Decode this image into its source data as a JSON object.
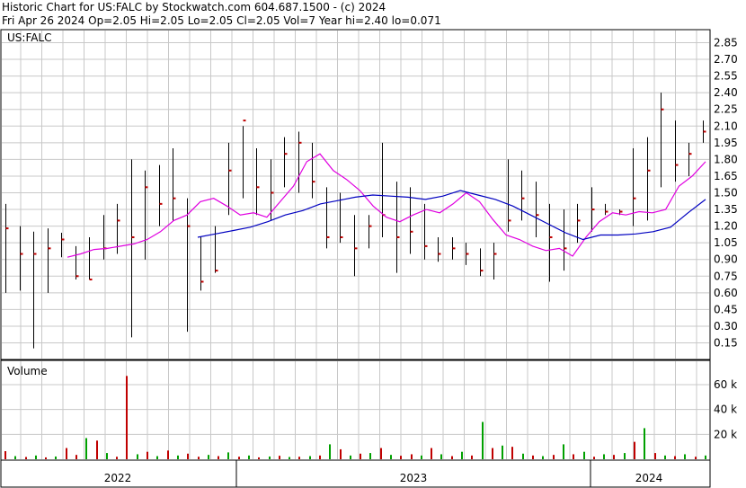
{
  "header": {
    "title": "Historic Chart for US:FALC by Stockwatch.com 604.687.1500 - (c) 2024",
    "quote": "Fri Apr 26 2024   Op=2.05  Hi=2.05  Lo=2.05  Cl=2.05  Vol=7  Year hi=2.40  lo=0.071"
  },
  "colors": {
    "ma_short": "#e000e0",
    "ma_long": "#0000c0",
    "up": "#00a000",
    "down": "#c00000",
    "grid": "#c8c8c8",
    "price_bar": "#000000",
    "close_tick": "#c00000"
  },
  "chart_data": [
    {
      "type": "line",
      "title": "US:FALC",
      "y_ticks": [
        "2.85",
        "2.70",
        "2.55",
        "2.40",
        "2.25",
        "2.10",
        "1.95",
        "1.80",
        "1.65",
        "1.50",
        "1.35",
        "1.20",
        "1.05",
        "0.90",
        "0.75",
        "0.60",
        "0.45",
        "0.30",
        "0.15"
      ],
      "ylim": [
        0,
        2.9
      ],
      "x_labels": [
        "2022",
        "2023",
        "2024"
      ],
      "x_range": [
        "2021-07",
        "2024-04"
      ],
      "series": [
        {
          "values": [
            0.92,
            0.95,
            0.99,
            1.0,
            1.02,
            1.04,
            1.08,
            1.15,
            1.25,
            1.3,
            1.42,
            1.45,
            1.38,
            1.3,
            1.32,
            1.28,
            1.42,
            1.56,
            1.78,
            1.85,
            1.7,
            1.62,
            1.52,
            1.38,
            1.28,
            1.24,
            1.3,
            1.35,
            1.32,
            1.4,
            1.5,
            1.42,
            1.26,
            1.12,
            1.08,
            1.02,
            0.98,
            1.0,
            0.93,
            1.1,
            1.24,
            1.32,
            1.3,
            1.33,
            1.32,
            1.35,
            1.56,
            1.65,
            1.78
          ]
        },
        {
          "values": [
            1.1,
            1.13,
            1.16,
            1.19,
            1.24,
            1.3,
            1.34,
            1.4,
            1.43,
            1.46,
            1.48,
            1.47,
            1.46,
            1.44,
            1.47,
            1.52,
            1.48,
            1.44,
            1.38,
            1.3,
            1.22,
            1.14,
            1.08,
            1.12,
            1.12,
            1.13,
            1.15,
            1.19,
            1.32,
            1.44
          ]
        }
      ],
      "bars": [
        {
          "hi": 1.4,
          "lo": 0.6,
          "cl": 1.18
        },
        {
          "hi": 1.2,
          "lo": 0.62,
          "cl": 0.95
        },
        {
          "hi": 1.15,
          "lo": 0.1,
          "cl": 0.95
        },
        {
          "hi": 1.18,
          "lo": 0.6,
          "cl": 1.0
        },
        {
          "hi": 1.14,
          "lo": 0.92,
          "cl": 1.08
        },
        {
          "hi": 1.02,
          "lo": 0.72,
          "cl": 0.75
        },
        {
          "hi": 1.1,
          "lo": 0.72,
          "cl": 0.72
        },
        {
          "hi": 1.3,
          "lo": 0.9,
          "cl": 1.0
        },
        {
          "hi": 1.4,
          "lo": 0.95,
          "cl": 1.25
        },
        {
          "hi": 1.8,
          "lo": 0.2,
          "cl": 1.1
        },
        {
          "hi": 1.7,
          "lo": 0.9,
          "cl": 1.55
        },
        {
          "hi": 1.75,
          "lo": 1.2,
          "cl": 1.4
        },
        {
          "hi": 1.9,
          "lo": 1.25,
          "cl": 1.45
        },
        {
          "hi": 1.45,
          "lo": 0.25,
          "cl": 1.2
        },
        {
          "hi": 1.1,
          "lo": 0.62,
          "cl": 0.7
        },
        {
          "hi": 1.2,
          "lo": 0.78,
          "cl": 0.8
        },
        {
          "hi": 1.95,
          "lo": 1.3,
          "cl": 1.7
        },
        {
          "hi": 2.1,
          "lo": 1.45,
          "cl": 2.15
        },
        {
          "hi": 1.9,
          "lo": 1.3,
          "cl": 1.55
        },
        {
          "hi": 1.8,
          "lo": 1.25,
          "cl": 1.5
        },
        {
          "hi": 2.0,
          "lo": 1.55,
          "cl": 1.85
        },
        {
          "hi": 2.05,
          "lo": 1.5,
          "cl": 1.95
        },
        {
          "hi": 1.95,
          "lo": 1.45,
          "cl": 1.6
        },
        {
          "hi": 1.55,
          "lo": 1.0,
          "cl": 1.1
        },
        {
          "hi": 1.5,
          "lo": 1.05,
          "cl": 1.1
        },
        {
          "hi": 1.3,
          "lo": 0.75,
          "cl": 1.0
        },
        {
          "hi": 1.3,
          "lo": 1.0,
          "cl": 1.2
        },
        {
          "hi": 1.95,
          "lo": 1.1,
          "cl": 1.3
        },
        {
          "hi": 1.6,
          "lo": 0.78,
          "cl": 1.1
        },
        {
          "hi": 1.55,
          "lo": 0.95,
          "cl": 1.15
        },
        {
          "hi": 1.4,
          "lo": 0.9,
          "cl": 1.02
        },
        {
          "hi": 1.1,
          "lo": 0.88,
          "cl": 0.95
        },
        {
          "hi": 1.1,
          "lo": 0.9,
          "cl": 1.0
        },
        {
          "hi": 1.05,
          "lo": 0.85,
          "cl": 0.95
        },
        {
          "hi": 1.0,
          "lo": 0.75,
          "cl": 0.8
        },
        {
          "hi": 1.05,
          "lo": 0.72,
          "cl": 0.95
        },
        {
          "hi": 1.8,
          "lo": 1.15,
          "cl": 1.25
        },
        {
          "hi": 1.7,
          "lo": 1.25,
          "cl": 1.45
        },
        {
          "hi": 1.6,
          "lo": 1.1,
          "cl": 1.3
        },
        {
          "hi": 1.4,
          "lo": 0.7,
          "cl": 1.1
        },
        {
          "hi": 1.35,
          "lo": 0.8,
          "cl": 1.0
        },
        {
          "hi": 1.4,
          "lo": 1.05,
          "cl": 1.25
        },
        {
          "hi": 1.55,
          "lo": 1.15,
          "cl": 1.35
        },
        {
          "hi": 1.4,
          "lo": 1.3,
          "cl": 1.33
        },
        {
          "hi": 1.35,
          "lo": 1.3,
          "cl": 1.33
        },
        {
          "hi": 1.9,
          "lo": 1.2,
          "cl": 1.45
        },
        {
          "hi": 2.0,
          "lo": 1.25,
          "cl": 1.7
        },
        {
          "hi": 2.4,
          "lo": 1.55,
          "cl": 2.25
        },
        {
          "hi": 2.15,
          "lo": 1.6,
          "cl": 1.75
        },
        {
          "hi": 1.95,
          "lo": 1.65,
          "cl": 1.85
        },
        {
          "hi": 2.15,
          "lo": 1.95,
          "cl": 2.05
        }
      ]
    },
    {
      "type": "bar",
      "title": "Volume",
      "y_ticks": [
        "60 k",
        "40 k",
        "20 k"
      ],
      "ylim": [
        0,
        70000
      ],
      "values": [
        {
          "v": 6500,
          "up": false
        },
        {
          "v": 2500,
          "up": true
        },
        {
          "v": 1800,
          "up": false
        },
        {
          "v": 3000,
          "up": true
        },
        {
          "v": 1500,
          "up": false
        },
        {
          "v": 2200,
          "up": true
        },
        {
          "v": 9000,
          "up": false
        },
        {
          "v": 3500,
          "up": false
        },
        {
          "v": 17000,
          "up": true
        },
        {
          "v": 15000,
          "up": false
        },
        {
          "v": 5000,
          "up": true
        },
        {
          "v": 2000,
          "up": false
        },
        {
          "v": 67000,
          "up": false
        },
        {
          "v": 4000,
          "up": true
        },
        {
          "v": 6000,
          "up": false
        },
        {
          "v": 2500,
          "up": true
        },
        {
          "v": 7000,
          "up": false
        },
        {
          "v": 3000,
          "up": true
        },
        {
          "v": 4500,
          "up": false
        },
        {
          "v": 2000,
          "up": false
        },
        {
          "v": 3500,
          "up": true
        },
        {
          "v": 2500,
          "up": false
        },
        {
          "v": 5500,
          "up": true
        },
        {
          "v": 2000,
          "up": false
        },
        {
          "v": 3000,
          "up": true
        },
        {
          "v": 1500,
          "up": false
        },
        {
          "v": 2200,
          "up": true
        },
        {
          "v": 2800,
          "up": false
        },
        {
          "v": 1800,
          "up": true
        },
        {
          "v": 2000,
          "up": false
        },
        {
          "v": 2500,
          "up": true
        },
        {
          "v": 3000,
          "up": false
        },
        {
          "v": 12000,
          "up": true
        },
        {
          "v": 8000,
          "up": false
        },
        {
          "v": 3000,
          "up": true
        },
        {
          "v": 4500,
          "up": false
        },
        {
          "v": 5000,
          "up": true
        },
        {
          "v": 9000,
          "up": false
        },
        {
          "v": 3500,
          "up": true
        },
        {
          "v": 2800,
          "up": false
        },
        {
          "v": 4000,
          "up": false
        },
        {
          "v": 3000,
          "up": true
        },
        {
          "v": 9000,
          "up": false
        },
        {
          "v": 4000,
          "up": true
        },
        {
          "v": 2500,
          "up": false
        },
        {
          "v": 6000,
          "up": true
        },
        {
          "v": 3000,
          "up": false
        },
        {
          "v": 30000,
          "up": true
        },
        {
          "v": 9000,
          "up": false
        },
        {
          "v": 11000,
          "up": true
        },
        {
          "v": 10000,
          "up": false
        },
        {
          "v": 4500,
          "up": true
        },
        {
          "v": 3000,
          "up": false
        },
        {
          "v": 2500,
          "up": true
        },
        {
          "v": 3500,
          "up": false
        },
        {
          "v": 12000,
          "up": true
        },
        {
          "v": 4000,
          "up": false
        },
        {
          "v": 6000,
          "up": true
        },
        {
          "v": 2000,
          "up": false
        },
        {
          "v": 4000,
          "up": true
        },
        {
          "v": 3500,
          "up": false
        },
        {
          "v": 5000,
          "up": true
        },
        {
          "v": 14000,
          "up": false
        },
        {
          "v": 25000,
          "up": true
        },
        {
          "v": 5000,
          "up": false
        },
        {
          "v": 3000,
          "up": true
        },
        {
          "v": 2500,
          "up": false
        },
        {
          "v": 4000,
          "up": true
        },
        {
          "v": 2000,
          "up": false
        },
        {
          "v": 3000,
          "up": true
        }
      ]
    }
  ]
}
